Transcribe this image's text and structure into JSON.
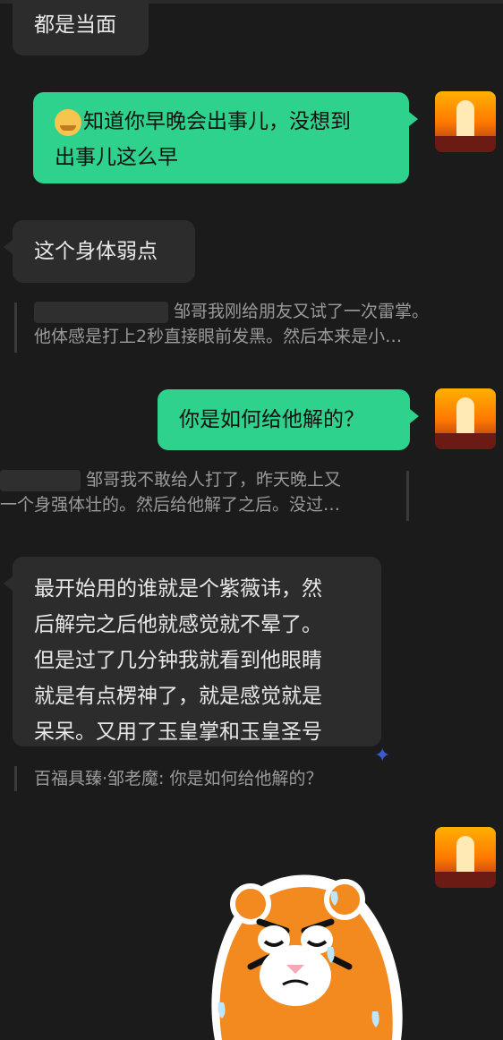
{
  "messages": [
    {
      "id": "m1",
      "side": "left",
      "text": "都是当面"
    },
    {
      "id": "m2",
      "side": "right",
      "line1": "知道你早晚会出事儿，没想到",
      "line2": "出事儿这么早",
      "emoji": "crying-laughing-emoji"
    },
    {
      "id": "m3",
      "side": "left",
      "text": "这个身体弱点"
    },
    {
      "id": "m4",
      "side": "right",
      "text": "你是如何给他解的？"
    },
    {
      "id": "m5",
      "side": "left",
      "lines": [
        "最开始用的谁就是个紫薇讳，然",
        "后解完之后他就感觉就不晕了。",
        "但是过了几分钟我就看到他眼睛",
        "就是有点楞神了，就是感觉就是",
        "呆呆。又用了玉皇掌和玉皇圣号"
      ]
    }
  ],
  "quotes": [
    {
      "id": "q1",
      "line1": "邹哥我刚给朋友又试了一次雷掌。",
      "line2": "他体感是打上2秒直接眼前发黑。然后本来是小…"
    },
    {
      "id": "q2",
      "line1": "邹哥我不敢给人打了，昨天晚上又",
      "line2": "一个身强体壮的。然后给他解了之后。没过…"
    },
    {
      "id": "q3",
      "line1": "百福具臻·邹老魔: 你是如何给他解的？"
    }
  ],
  "icons": {
    "sparkle": "sparkle-icon",
    "sticker": "crying-tiger-sticker"
  },
  "colors": {
    "background": "#1b1b1b",
    "bubble_left": "#2c2c2c",
    "bubble_right": "#2fd28c"
  }
}
